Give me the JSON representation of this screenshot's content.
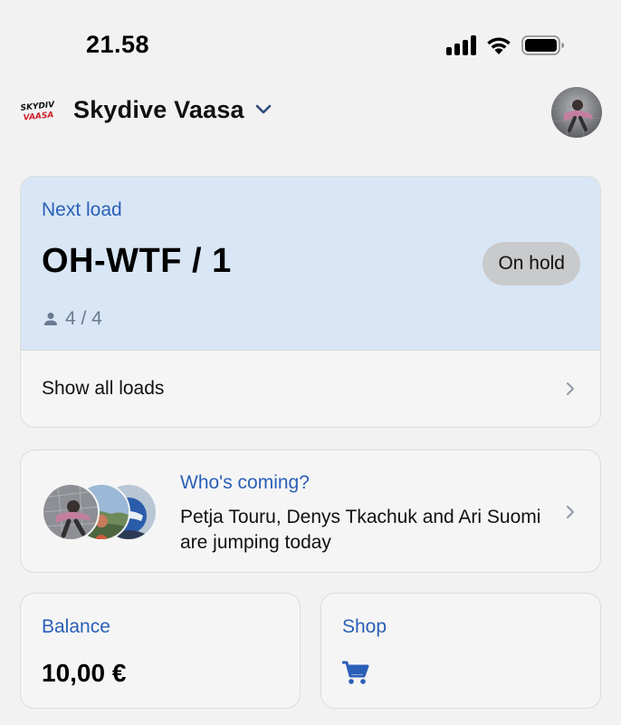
{
  "status_bar": {
    "time": "21.58"
  },
  "header": {
    "logo_text": "SKYDIVE VAASA",
    "club_name": "Skydive Vaasa"
  },
  "next_load": {
    "label": "Next load",
    "name": "OH-WTF / 1",
    "status": "On hold",
    "capacity": "4 / 4",
    "show_all_label": "Show all loads"
  },
  "whos_coming": {
    "title": "Who's coming?",
    "text": "Petja Touru, Denys Tkachuk and Ari Suomi are jumping today"
  },
  "balance": {
    "label": "Balance",
    "value": "10,00 €"
  },
  "shop": {
    "label": "Shop"
  },
  "colors": {
    "accent": "#2a5fb8",
    "load_card_bg": "#d8e6f5",
    "badge_bg": "#c9cacc"
  }
}
